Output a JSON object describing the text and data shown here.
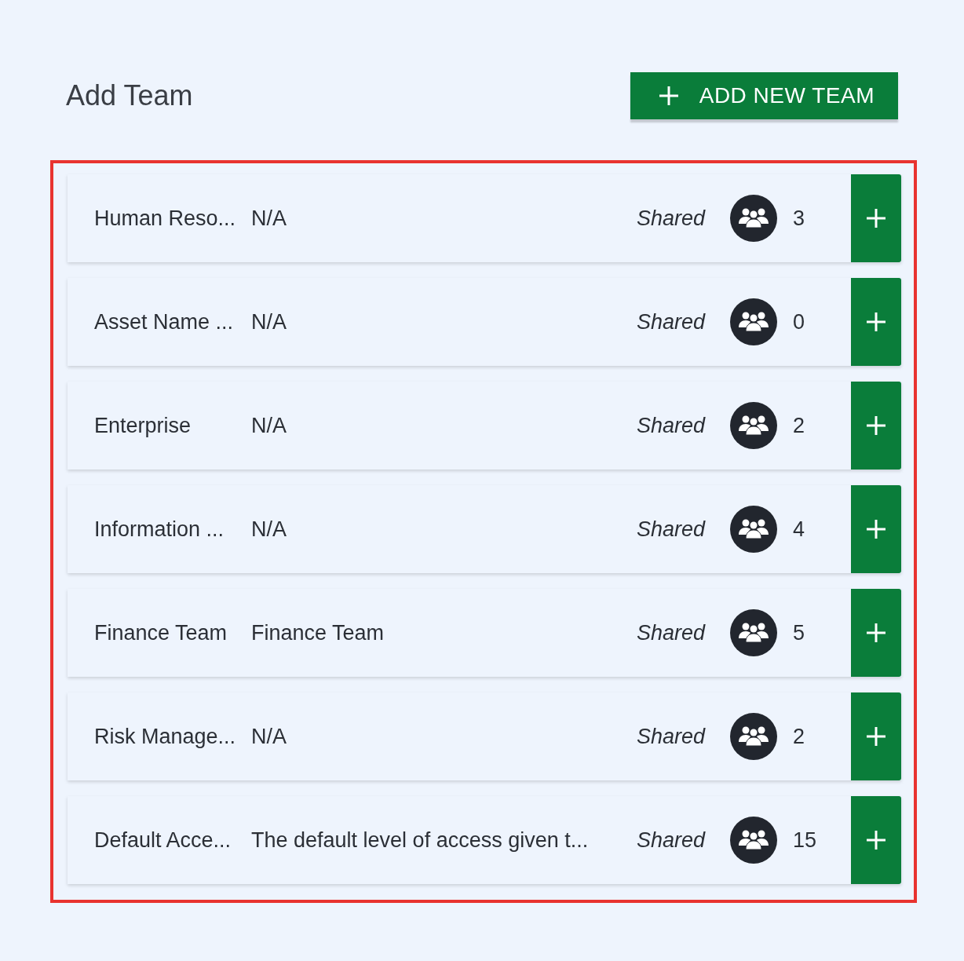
{
  "title": "Add Team",
  "add_button": {
    "label": "ADD NEW TEAM"
  },
  "teams": [
    {
      "name": "Human Reso...",
      "description": "N/A",
      "sharing": "Shared",
      "members": "3"
    },
    {
      "name": "Asset Name ...",
      "description": "N/A",
      "sharing": "Shared",
      "members": "0"
    },
    {
      "name": "Enterprise",
      "description": "N/A",
      "sharing": "Shared",
      "members": "2"
    },
    {
      "name": "Information ...",
      "description": "N/A",
      "sharing": "Shared",
      "members": "4"
    },
    {
      "name": "Finance Team",
      "description": "Finance Team",
      "sharing": "Shared",
      "members": "5"
    },
    {
      "name": "Risk Manage...",
      "description": "N/A",
      "sharing": "Shared",
      "members": "2"
    },
    {
      "name": "Default Acce...",
      "description": "The default level of access given t...",
      "sharing": "Shared",
      "members": "15"
    }
  ]
}
